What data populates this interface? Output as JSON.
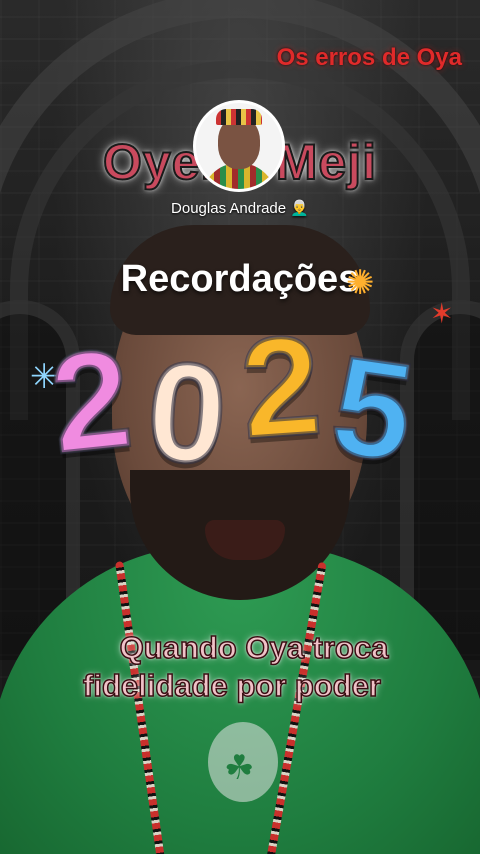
{
  "overlay": {
    "top_right_title": "Os erros de Oya",
    "channel_title": "Oyeku Meji",
    "creator_name": "Douglas Andrade 👨‍🦳",
    "headline": "Recordações",
    "year_digits": [
      "2",
      "0",
      "2",
      "5"
    ],
    "caption_lines": [
      "Quando Oya troca",
      "fidelidade por poder"
    ]
  },
  "colors": {
    "top_right_title": "#e02a2a",
    "channel_title": "#c94a5e",
    "caption": "#f0c2c8",
    "shirt": "#1f7d3f",
    "year_digit_colors": [
      "#f08be0",
      "#ffe7d3",
      "#f9b72a",
      "#4fb2f2"
    ]
  },
  "icons": {
    "avatar": "creator-avatar",
    "sparkle_left": "firework-burst-icon",
    "sparkle_right": "firework-burst-icon",
    "shirt_logo": "shamrock-icon"
  }
}
